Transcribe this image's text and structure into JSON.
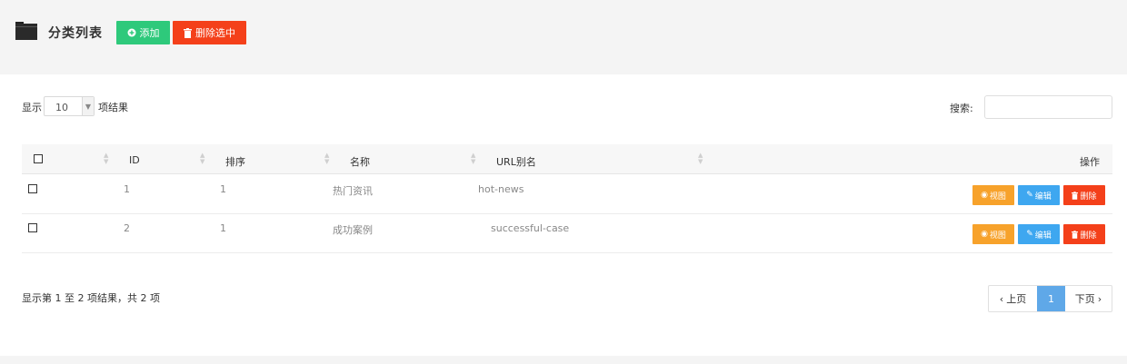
{
  "header": {
    "title": "分类列表",
    "add_label": "添加",
    "delete_selected_label": "删除选中"
  },
  "length_menu": {
    "prefix": "显示",
    "value": "10",
    "suffix": "项结果"
  },
  "search": {
    "label": "搜索:",
    "value": "",
    "placeholder": ""
  },
  "table": {
    "columns": [
      "ID",
      "排序",
      "名称",
      "URL别名",
      "操作"
    ],
    "rows": [
      {
        "id": "1",
        "sort": "1",
        "name": "热门资讯",
        "url_alias": "hot-news"
      },
      {
        "id": "2",
        "sort": "1",
        "name": "成功案例",
        "url_alias": "successful-case"
      }
    ],
    "actions": {
      "view": "视图",
      "edit": "编辑",
      "delete": "删除"
    }
  },
  "footer": {
    "info": "显示第 1 至 2 项结果，共 2 项"
  },
  "pagination": {
    "prev": "上页",
    "current": "1",
    "next": "下页"
  },
  "colors": {
    "add": "#2ec97b",
    "danger": "#f4401a",
    "view": "#f7a22b",
    "edit": "#3ea7f0",
    "active_page": "#5fa8e8"
  }
}
